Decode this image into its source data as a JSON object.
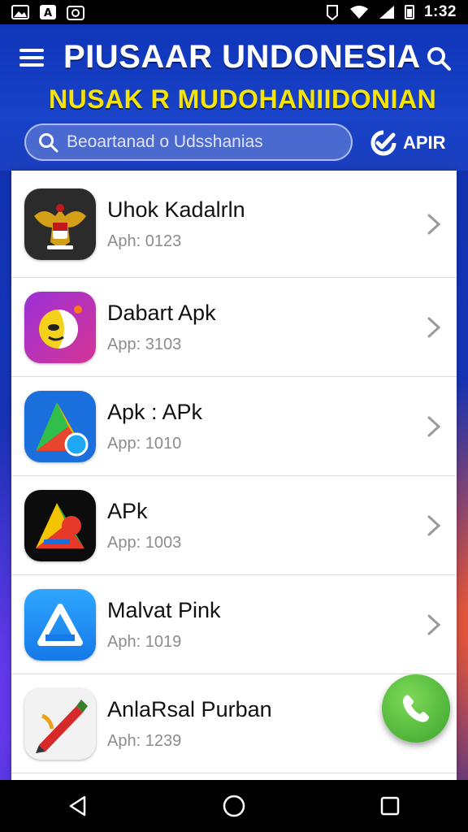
{
  "status_bar": {
    "time": "1:32",
    "icons": [
      "image-icon",
      "translate-icon",
      "camera-icon",
      "alarm-icon",
      "wifi-icon",
      "signal-icon",
      "battery-icon"
    ]
  },
  "header": {
    "title": "PIUSAAR UNDONESIA",
    "subtitle": "NUSAK R MUDOHANIIDONIAN",
    "search_placeholder": "Beoartanad o Udsshanias",
    "apk_button_label": "APIR"
  },
  "apps": [
    {
      "name": "Uhok Kadalrln",
      "sub": "Aph: 0123",
      "icon": "garuda-emblem-icon"
    },
    {
      "name": "Dabart Apk",
      "sub": "App: 3103",
      "icon": "cartoon-face-icon"
    },
    {
      "name": "Apk : APk",
      "sub": "App: 1010",
      "icon": "play-triangle-icon"
    },
    {
      "name": "APk",
      "sub": "App: 1003",
      "icon": "apk-triangle-icon"
    },
    {
      "name": "Malvat Pink",
      "sub": "Aph: 1019",
      "icon": "delta-icon"
    },
    {
      "name": "AnlaRsal Purban",
      "sub": "Aph: 1239",
      "icon": "pen-icon"
    }
  ],
  "colors": {
    "header_bg": "#1842c8",
    "subtitle_yellow": "#f4e40a",
    "fab_green": "#3aa52c"
  }
}
